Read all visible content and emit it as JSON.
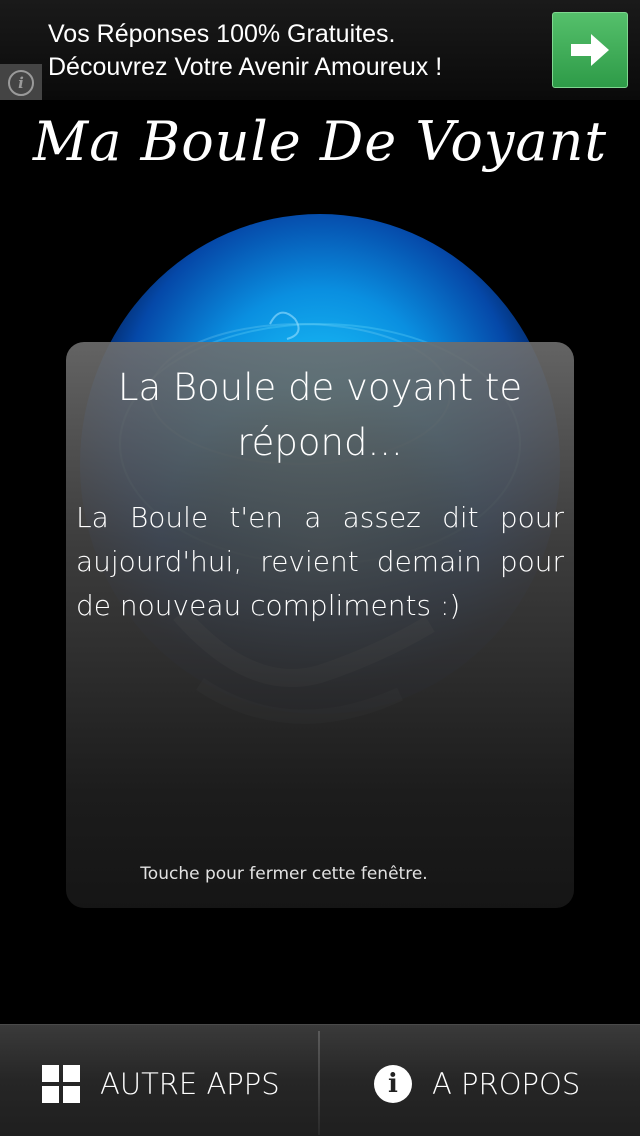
{
  "ad": {
    "line1": "Vos Réponses 100% Gratuites.",
    "line2": "Découvrez Votre Avenir Amoureux !",
    "info_icon": "info-icon",
    "arrow_icon": "arrow-right-icon",
    "accent": "#3aa754"
  },
  "app": {
    "title": "Ma Boule De Voyant"
  },
  "modal": {
    "title": "La Boule de voyant te répond...",
    "body": "La Boule t'en a assez dit pour aujourd'hui, revient demain pour de nouveau compliments :)",
    "hint": "Touche pour fermer cette fenêtre."
  },
  "bottom_bar": {
    "apps_label": "AUTRE APPS",
    "apps_icon": "grid-icon",
    "about_label": "A PROPOS",
    "about_icon": "info-circle-icon"
  }
}
